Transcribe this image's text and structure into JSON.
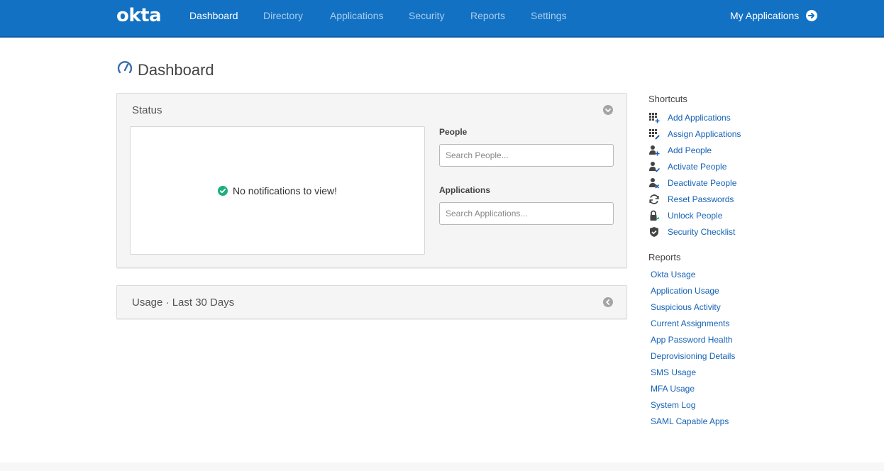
{
  "nav": {
    "logo": "okta",
    "items": [
      {
        "label": "Dashboard",
        "active": true
      },
      {
        "label": "Directory",
        "active": false
      },
      {
        "label": "Applications",
        "active": false
      },
      {
        "label": "Security",
        "active": false
      },
      {
        "label": "Reports",
        "active": false
      },
      {
        "label": "Settings",
        "active": false
      }
    ],
    "my_applications": "My Applications"
  },
  "page": {
    "title": "Dashboard"
  },
  "status_panel": {
    "header": "Status",
    "notification": "No notifications to view!",
    "people_label": "People",
    "people_placeholder": "Search People...",
    "applications_label": "Applications",
    "applications_placeholder": "Search Applications..."
  },
  "usage_panel": {
    "header": "Usage · Last 30 Days"
  },
  "shortcuts": {
    "heading": "Shortcuts",
    "items": [
      {
        "label": "Add Applications",
        "icon": "grid-plus-icon"
      },
      {
        "label": "Assign Applications",
        "icon": "grid-assign-icon"
      },
      {
        "label": "Add People",
        "icon": "person-plus-icon"
      },
      {
        "label": "Activate People",
        "icon": "person-check-icon"
      },
      {
        "label": "Deactivate People",
        "icon": "person-x-icon"
      },
      {
        "label": "Reset Passwords",
        "icon": "refresh-icon"
      },
      {
        "label": "Unlock People",
        "icon": "lock-icon"
      },
      {
        "label": "Security Checklist",
        "icon": "shield-check-icon"
      }
    ]
  },
  "reports": {
    "heading": "Reports",
    "items": [
      "Okta Usage",
      "Application Usage",
      "Suspicious Activity",
      "Current Assignments",
      "App Password Health",
      "Deprovisioning Details",
      "SMS Usage",
      "MFA Usage",
      "System Log",
      "SAML Capable Apps"
    ]
  },
  "colors": {
    "nav_bg": "#1271c3",
    "link": "#1662b5",
    "success": "#1cb07a"
  }
}
